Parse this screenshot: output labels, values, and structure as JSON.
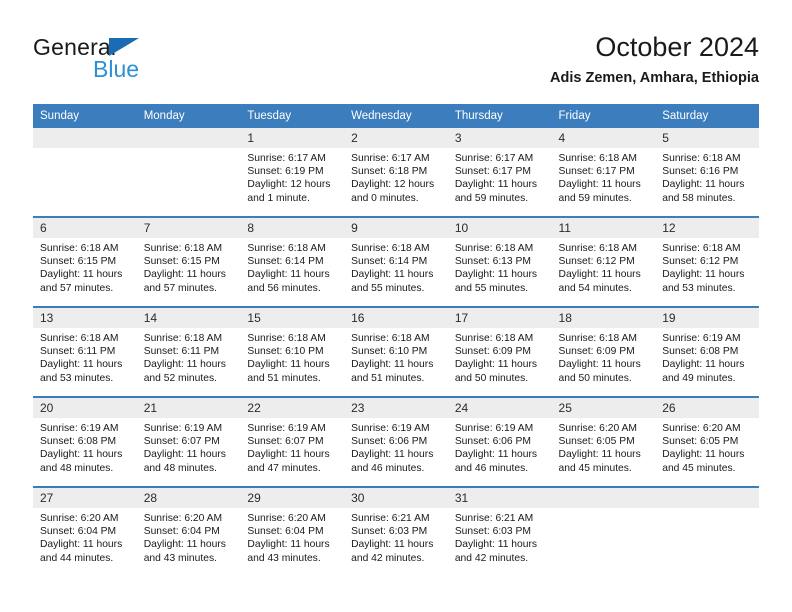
{
  "brand": {
    "word_top": "General",
    "word_bottom": "Blue",
    "triangle_icon": "blue-triangle-logo-mark",
    "color_top": "#1a1a1a",
    "color_bottom": "#2d8fd5",
    "triangle_color": "#1b6cb5"
  },
  "header": {
    "title": "October 2024",
    "subtitle": "Adis Zemen, Amhara, Ethiopia"
  },
  "theme": {
    "header_bg": "#3b7dbd",
    "header_text": "#ffffff",
    "daynum_bg": "#ededed",
    "cell_bg": "#ffffff",
    "row_rule": "#3b7dbd"
  },
  "weekday_headers": [
    "Sunday",
    "Monday",
    "Tuesday",
    "Wednesday",
    "Thursday",
    "Friday",
    "Saturday"
  ],
  "weeks": [
    [
      {
        "day": "",
        "sunrise": "",
        "sunset": "",
        "daylight1": "",
        "daylight2": ""
      },
      {
        "day": "",
        "sunrise": "",
        "sunset": "",
        "daylight1": "",
        "daylight2": ""
      },
      {
        "day": "1",
        "sunrise": "Sunrise: 6:17 AM",
        "sunset": "Sunset: 6:19 PM",
        "daylight1": "Daylight: 12 hours",
        "daylight2": "and 1 minute."
      },
      {
        "day": "2",
        "sunrise": "Sunrise: 6:17 AM",
        "sunset": "Sunset: 6:18 PM",
        "daylight1": "Daylight: 12 hours",
        "daylight2": "and 0 minutes."
      },
      {
        "day": "3",
        "sunrise": "Sunrise: 6:17 AM",
        "sunset": "Sunset: 6:17 PM",
        "daylight1": "Daylight: 11 hours",
        "daylight2": "and 59 minutes."
      },
      {
        "day": "4",
        "sunrise": "Sunrise: 6:18 AM",
        "sunset": "Sunset: 6:17 PM",
        "daylight1": "Daylight: 11 hours",
        "daylight2": "and 59 minutes."
      },
      {
        "day": "5",
        "sunrise": "Sunrise: 6:18 AM",
        "sunset": "Sunset: 6:16 PM",
        "daylight1": "Daylight: 11 hours",
        "daylight2": "and 58 minutes."
      }
    ],
    [
      {
        "day": "6",
        "sunrise": "Sunrise: 6:18 AM",
        "sunset": "Sunset: 6:15 PM",
        "daylight1": "Daylight: 11 hours",
        "daylight2": "and 57 minutes."
      },
      {
        "day": "7",
        "sunrise": "Sunrise: 6:18 AM",
        "sunset": "Sunset: 6:15 PM",
        "daylight1": "Daylight: 11 hours",
        "daylight2": "and 57 minutes."
      },
      {
        "day": "8",
        "sunrise": "Sunrise: 6:18 AM",
        "sunset": "Sunset: 6:14 PM",
        "daylight1": "Daylight: 11 hours",
        "daylight2": "and 56 minutes."
      },
      {
        "day": "9",
        "sunrise": "Sunrise: 6:18 AM",
        "sunset": "Sunset: 6:14 PM",
        "daylight1": "Daylight: 11 hours",
        "daylight2": "and 55 minutes."
      },
      {
        "day": "10",
        "sunrise": "Sunrise: 6:18 AM",
        "sunset": "Sunset: 6:13 PM",
        "daylight1": "Daylight: 11 hours",
        "daylight2": "and 55 minutes."
      },
      {
        "day": "11",
        "sunrise": "Sunrise: 6:18 AM",
        "sunset": "Sunset: 6:12 PM",
        "daylight1": "Daylight: 11 hours",
        "daylight2": "and 54 minutes."
      },
      {
        "day": "12",
        "sunrise": "Sunrise: 6:18 AM",
        "sunset": "Sunset: 6:12 PM",
        "daylight1": "Daylight: 11 hours",
        "daylight2": "and 53 minutes."
      }
    ],
    [
      {
        "day": "13",
        "sunrise": "Sunrise: 6:18 AM",
        "sunset": "Sunset: 6:11 PM",
        "daylight1": "Daylight: 11 hours",
        "daylight2": "and 53 minutes."
      },
      {
        "day": "14",
        "sunrise": "Sunrise: 6:18 AM",
        "sunset": "Sunset: 6:11 PM",
        "daylight1": "Daylight: 11 hours",
        "daylight2": "and 52 minutes."
      },
      {
        "day": "15",
        "sunrise": "Sunrise: 6:18 AM",
        "sunset": "Sunset: 6:10 PM",
        "daylight1": "Daylight: 11 hours",
        "daylight2": "and 51 minutes."
      },
      {
        "day": "16",
        "sunrise": "Sunrise: 6:18 AM",
        "sunset": "Sunset: 6:10 PM",
        "daylight1": "Daylight: 11 hours",
        "daylight2": "and 51 minutes."
      },
      {
        "day": "17",
        "sunrise": "Sunrise: 6:18 AM",
        "sunset": "Sunset: 6:09 PM",
        "daylight1": "Daylight: 11 hours",
        "daylight2": "and 50 minutes."
      },
      {
        "day": "18",
        "sunrise": "Sunrise: 6:18 AM",
        "sunset": "Sunset: 6:09 PM",
        "daylight1": "Daylight: 11 hours",
        "daylight2": "and 50 minutes."
      },
      {
        "day": "19",
        "sunrise": "Sunrise: 6:19 AM",
        "sunset": "Sunset: 6:08 PM",
        "daylight1": "Daylight: 11 hours",
        "daylight2": "and 49 minutes."
      }
    ],
    [
      {
        "day": "20",
        "sunrise": "Sunrise: 6:19 AM",
        "sunset": "Sunset: 6:08 PM",
        "daylight1": "Daylight: 11 hours",
        "daylight2": "and 48 minutes."
      },
      {
        "day": "21",
        "sunrise": "Sunrise: 6:19 AM",
        "sunset": "Sunset: 6:07 PM",
        "daylight1": "Daylight: 11 hours",
        "daylight2": "and 48 minutes."
      },
      {
        "day": "22",
        "sunrise": "Sunrise: 6:19 AM",
        "sunset": "Sunset: 6:07 PM",
        "daylight1": "Daylight: 11 hours",
        "daylight2": "and 47 minutes."
      },
      {
        "day": "23",
        "sunrise": "Sunrise: 6:19 AM",
        "sunset": "Sunset: 6:06 PM",
        "daylight1": "Daylight: 11 hours",
        "daylight2": "and 46 minutes."
      },
      {
        "day": "24",
        "sunrise": "Sunrise: 6:19 AM",
        "sunset": "Sunset: 6:06 PM",
        "daylight1": "Daylight: 11 hours",
        "daylight2": "and 46 minutes."
      },
      {
        "day": "25",
        "sunrise": "Sunrise: 6:20 AM",
        "sunset": "Sunset: 6:05 PM",
        "daylight1": "Daylight: 11 hours",
        "daylight2": "and 45 minutes."
      },
      {
        "day": "26",
        "sunrise": "Sunrise: 6:20 AM",
        "sunset": "Sunset: 6:05 PM",
        "daylight1": "Daylight: 11 hours",
        "daylight2": "and 45 minutes."
      }
    ],
    [
      {
        "day": "27",
        "sunrise": "Sunrise: 6:20 AM",
        "sunset": "Sunset: 6:04 PM",
        "daylight1": "Daylight: 11 hours",
        "daylight2": "and 44 minutes."
      },
      {
        "day": "28",
        "sunrise": "Sunrise: 6:20 AM",
        "sunset": "Sunset: 6:04 PM",
        "daylight1": "Daylight: 11 hours",
        "daylight2": "and 43 minutes."
      },
      {
        "day": "29",
        "sunrise": "Sunrise: 6:20 AM",
        "sunset": "Sunset: 6:04 PM",
        "daylight1": "Daylight: 11 hours",
        "daylight2": "and 43 minutes."
      },
      {
        "day": "30",
        "sunrise": "Sunrise: 6:21 AM",
        "sunset": "Sunset: 6:03 PM",
        "daylight1": "Daylight: 11 hours",
        "daylight2": "and 42 minutes."
      },
      {
        "day": "31",
        "sunrise": "Sunrise: 6:21 AM",
        "sunset": "Sunset: 6:03 PM",
        "daylight1": "Daylight: 11 hours",
        "daylight2": "and 42 minutes."
      },
      {
        "day": "",
        "sunrise": "",
        "sunset": "",
        "daylight1": "",
        "daylight2": ""
      },
      {
        "day": "",
        "sunrise": "",
        "sunset": "",
        "daylight1": "",
        "daylight2": ""
      }
    ]
  ]
}
